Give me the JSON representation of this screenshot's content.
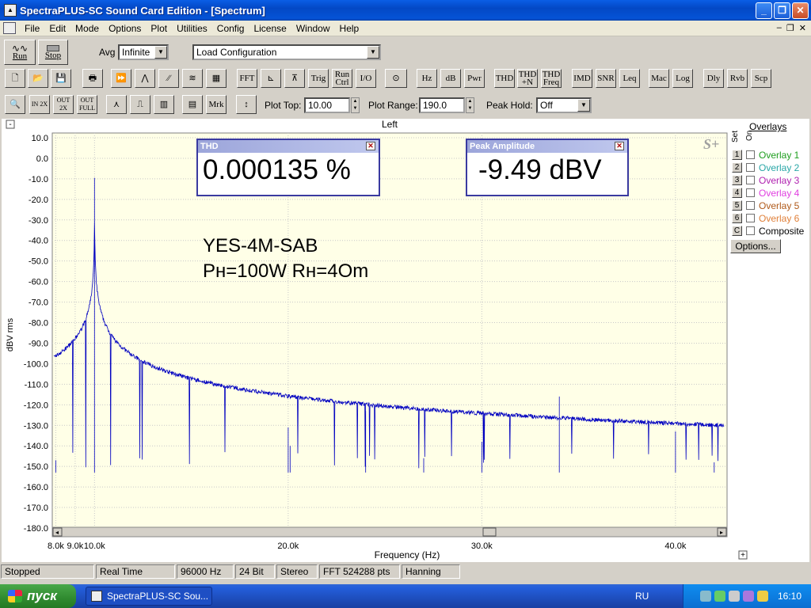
{
  "window": {
    "title": "SpectraPLUS-SC Sound Card Edition - [Spectrum]",
    "app_icon": "spectra-app-icon"
  },
  "menu": [
    "File",
    "Edit",
    "Mode",
    "Options",
    "Plot",
    "Utilities",
    "Config",
    "License",
    "Window",
    "Help"
  ],
  "toolbar1": {
    "run_label": "Run",
    "stop_label": "Stop",
    "avg_label": "Avg",
    "avg_value": "Infinite",
    "config_value": "Load Configuration"
  },
  "toolbar2": {
    "buttons": [
      "FFT",
      "Trig",
      "Run Ctrl",
      "I/O",
      "Hz",
      "dB",
      "Pwr",
      "THD",
      "THD +N",
      "THD Freq",
      "IMD",
      "SNR",
      "Leq",
      "Mac",
      "Log",
      "Dly",
      "Rvb",
      "Scp"
    ]
  },
  "toolbar3": {
    "zoom_buttons": [
      "IN 2X",
      "OUT 2X",
      "OUT FULL"
    ],
    "mrk_label": "Mrk",
    "plot_top_label": "Plot Top:",
    "plot_top_value": "10.00",
    "plot_range_label": "Plot Range:",
    "plot_range_value": "190.0",
    "peak_hold_label": "Peak Hold:",
    "peak_hold_value": "Off"
  },
  "plot": {
    "channel_label": "Left",
    "sp_logo": "S+",
    "annotation_line1": "YES-4M-SAB",
    "annotation_line2": "Pн=100W  Rн=4Om"
  },
  "thd_box": {
    "title": "THD",
    "value": "0.000135 %"
  },
  "peak_box": {
    "title": "Peak Amplitude",
    "value": "-9.49 dBV"
  },
  "overlays": {
    "title": "Overlays",
    "col_set": "Set",
    "col_on": "On",
    "items": [
      {
        "num": "1",
        "label": "Overlay 1",
        "color": "#1f9e1f"
      },
      {
        "num": "2",
        "label": "Overlay 2",
        "color": "#2aa7a7"
      },
      {
        "num": "3",
        "label": "Overlay 3",
        "color": "#b022b0"
      },
      {
        "num": "4",
        "label": "Overlay 4",
        "color": "#e040e0"
      },
      {
        "num": "5",
        "label": "Overlay 5",
        "color": "#b05a1a"
      },
      {
        "num": "6",
        "label": "Overlay 6",
        "color": "#e0803a"
      },
      {
        "num": "C",
        "label": "Composite",
        "color": "#000000"
      }
    ],
    "options_label": "Options..."
  },
  "chart_data": {
    "type": "line",
    "xlabel": "Frequency (Hz)",
    "ylabel": "dBV rms",
    "xlim": [
      7900,
      42500
    ],
    "ylim": [
      -180,
      10
    ],
    "y_ticks": [
      "10.0",
      "0.0",
      "-10.0",
      "-20.0",
      "-30.0",
      "-40.0",
      "-50.0",
      "-60.0",
      "-70.0",
      "-80.0",
      "-90.0",
      "-100.0",
      "-110.0",
      "-120.0",
      "-130.0",
      "-140.0",
      "-150.0",
      "-160.0",
      "-170.0",
      "-180.0"
    ],
    "x_ticks": [
      {
        "value": 8000,
        "label": "8.0k"
      },
      {
        "value": 9000,
        "label": "9.0k"
      },
      {
        "value": 10000,
        "label": "10.0k"
      },
      {
        "value": 20000,
        "label": "20.0k"
      },
      {
        "value": 30000,
        "label": "30.0k"
      },
      {
        "value": 40000,
        "label": "40.0k"
      }
    ],
    "grid": true,
    "line_color": "#0000c0",
    "noise_floor": -153,
    "peaks": [
      {
        "x": 8000,
        "y": -147
      },
      {
        "x": 10000,
        "y": -9.5
      },
      {
        "x": 20000,
        "y": -131
      },
      {
        "x": 20100,
        "y": -140
      },
      {
        "x": 24000,
        "y": -123
      },
      {
        "x": 27000,
        "y": -146
      },
      {
        "x": 30000,
        "y": -138
      },
      {
        "x": 34000,
        "y": -116
      },
      {
        "x": 40000,
        "y": -133
      },
      {
        "x": 42000,
        "y": -148
      }
    ]
  },
  "status": [
    "Stopped",
    "Real Time",
    "96000 Hz",
    "24 Bit",
    "Stereo",
    "FFT 524288 pts",
    "Hanning"
  ],
  "taskbar": {
    "start_label": "пуск",
    "task_label": "SpectraPLUS-SC Sou...",
    "lang": "RU",
    "clock": "16:10"
  }
}
